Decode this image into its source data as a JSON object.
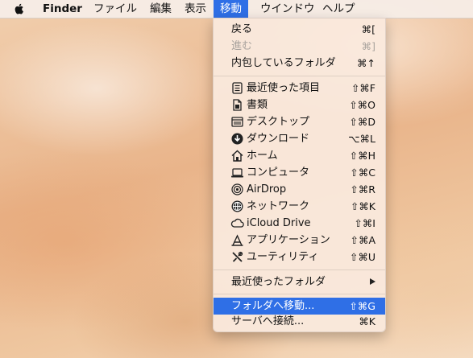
{
  "menubar": {
    "apple": "apple-logo",
    "items": [
      {
        "label": "Finder"
      },
      {
        "label": "ファイル"
      },
      {
        "label": "編集"
      },
      {
        "label": "表示"
      },
      {
        "label": "移動"
      },
      {
        "label": "ウインドウ"
      },
      {
        "label": "ヘルプ"
      }
    ],
    "active_index": 4
  },
  "go_menu": {
    "items": [
      {
        "label": "戻る",
        "shortcut": "⌘[",
        "enabled": true
      },
      {
        "label": "進む",
        "shortcut": "⌘]",
        "enabled": false
      },
      {
        "label": "内包しているフォルダ",
        "shortcut": "⌘↑",
        "enabled": true
      },
      {
        "label": "最近使った項目",
        "shortcut": "⇧⌘F",
        "icon": "recents-icon"
      },
      {
        "label": "書類",
        "shortcut": "⇧⌘O",
        "icon": "documents-icon"
      },
      {
        "label": "デスクトップ",
        "shortcut": "⇧⌘D",
        "icon": "desktop-icon"
      },
      {
        "label": "ダウンロード",
        "shortcut": "⌥⌘L",
        "icon": "downloads-icon"
      },
      {
        "label": "ホーム",
        "shortcut": "⇧⌘H",
        "icon": "home-icon"
      },
      {
        "label": "コンピュータ",
        "shortcut": "⇧⌘C",
        "icon": "computer-icon"
      },
      {
        "label": "AirDrop",
        "shortcut": "⇧⌘R",
        "icon": "airdrop-icon"
      },
      {
        "label": "ネットワーク",
        "shortcut": "⇧⌘K",
        "icon": "network-icon"
      },
      {
        "label": "iCloud Drive",
        "shortcut": "⇧⌘I",
        "icon": "icloud-icon"
      },
      {
        "label": "アプリケーション",
        "shortcut": "⇧⌘A",
        "icon": "applications-icon"
      },
      {
        "label": "ユーティリティ",
        "shortcut": "⇧⌘U",
        "icon": "utilities-icon"
      },
      {
        "label": "最近使ったフォルダ",
        "submenu": true
      },
      {
        "label": "フォルダへ移動...",
        "shortcut": "⇧⌘G",
        "highlighted": true
      },
      {
        "label": "サーバへ接続...",
        "shortcut": "⌘K"
      }
    ]
  },
  "colors": {
    "highlight": "#2f6fe6"
  }
}
